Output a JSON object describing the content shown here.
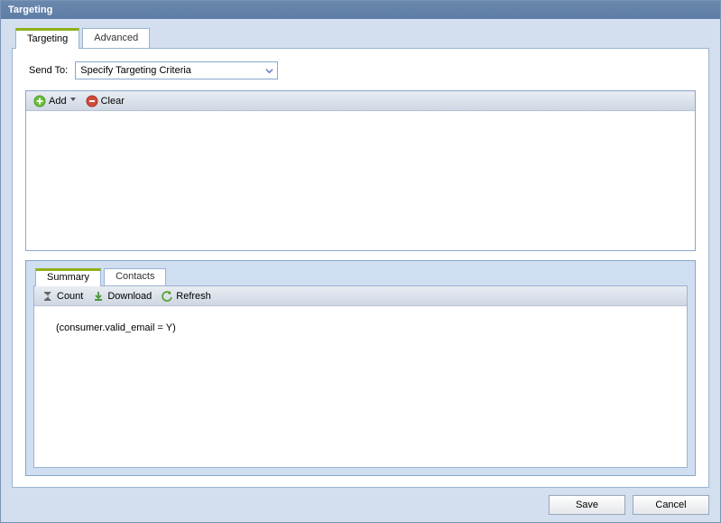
{
  "window": {
    "title": "Targeting"
  },
  "tabs": {
    "targeting": "Targeting",
    "advanced": "Advanced"
  },
  "sendto": {
    "label": "Send To:",
    "selected": "Specify Targeting Criteria"
  },
  "criteria_toolbar": {
    "add": "Add",
    "clear": "Clear"
  },
  "lower_tabs": {
    "summary": "Summary",
    "contacts": "Contacts"
  },
  "summary_toolbar": {
    "count": "Count",
    "download": "Download",
    "refresh": "Refresh"
  },
  "summary_body": {
    "expression": "(consumer.valid_email = Y)"
  },
  "footer": {
    "save": "Save",
    "cancel": "Cancel"
  }
}
